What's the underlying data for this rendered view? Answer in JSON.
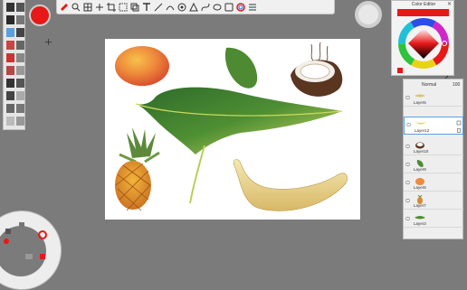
{
  "color_editor": {
    "title": "Color Editor",
    "close": "✕",
    "current_color": "#e81818"
  },
  "layer_panel": {
    "blend_mode": "Normal",
    "opacity": "100",
    "layers": [
      {
        "name": "Layer5",
        "selected": false
      },
      {
        "name": "Layer12",
        "selected": true
      },
      {
        "name": "Layer10",
        "selected": false
      },
      {
        "name": "Layer9",
        "selected": false
      },
      {
        "name": "Layer8",
        "selected": false
      },
      {
        "name": "Layer7",
        "selected": false
      },
      {
        "name": "Layer3",
        "selected": false
      }
    ]
  },
  "toolbar": {
    "icons": [
      "brush-icon",
      "zoom-icon",
      "grid-icon",
      "transform-icon",
      "crop-icon",
      "selection-icon",
      "layer-copy-icon",
      "text-icon",
      "ruler-icon",
      "stroke-icon",
      "symmetry-icon",
      "perspective-icon",
      "curve-icon",
      "ellipse-icon",
      "flipbook-icon",
      "color-wheel-icon",
      "list-icon"
    ]
  },
  "colors": {
    "accent": "#e81818",
    "background": "#7b7b7b",
    "canvas": "#ffffff"
  }
}
